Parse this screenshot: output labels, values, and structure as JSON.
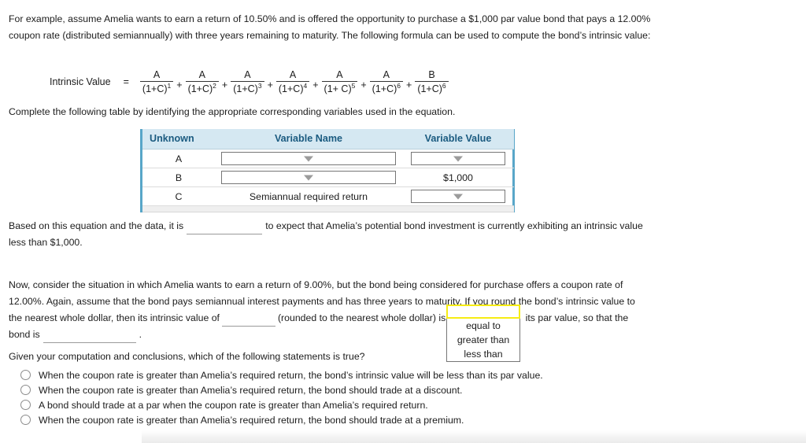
{
  "intro_paragraph": "For example, assume Amelia wants to earn a return of 10.50% and is offered the opportunity to purchase a $1,000 par value bond that pays a 12.00% coupon rate (distributed semiannually) with three years remaining to maturity. The following formula can be used to compute the bond’s intrinsic value:",
  "formula": {
    "label": "Intrinsic Value",
    "equals": "=",
    "plus": "+",
    "terms": [
      {
        "numerator": "A",
        "base": "(1+C)",
        "exponent": "1"
      },
      {
        "numerator": "A",
        "base": "(1+C)",
        "exponent": "2"
      },
      {
        "numerator": "A",
        "base": "(1+C)",
        "exponent": "3"
      },
      {
        "numerator": "A",
        "base": "(1+C)",
        "exponent": "4"
      },
      {
        "numerator": "A",
        "base": "(1+ C)",
        "exponent": "5"
      },
      {
        "numerator": "A",
        "base": "(1+C)",
        "exponent": "6"
      },
      {
        "numerator": "B",
        "base": "(1+C)",
        "exponent": "6"
      }
    ]
  },
  "complete_line": "Complete the following table by identifying the appropriate corresponding variables used in the equation.",
  "table": {
    "headers": [
      "Unknown",
      "Variable Name",
      "Variable Value"
    ],
    "rows": [
      {
        "unknown": "A",
        "variable_name": "",
        "variable_name_type": "select",
        "variable_value": "",
        "variable_value_type": "select"
      },
      {
        "unknown": "B",
        "variable_name": "",
        "variable_name_type": "select",
        "variable_value": "$1,000",
        "variable_value_type": "text"
      },
      {
        "unknown": "C",
        "variable_name": "Semiannual required return",
        "variable_name_type": "text",
        "variable_value": "",
        "variable_value_type": "select"
      }
    ]
  },
  "based_paragraph": {
    "part1": "Based on this equation and the data, it is",
    "part2": "to expect that Amelia’s potential bond investment is currently exhibiting an intrinsic value less than $1,000."
  },
  "now_paragraph": {
    "part1": "Now, consider the situation in which Amelia wants to earn a return of 9.00%, but the bond being considered for purchase offers a coupon rate of 12.00%. Again, assume that the bond pays semiannual interest payments and has three years to maturity. If you round the bond’s intrinsic value to the nearest whole dollar, then its intrinsic value of",
    "part2": "(rounded to the nearest whole dollar) is",
    "part3": "its par value, so that the bond is",
    "part4": "."
  },
  "dropdown": {
    "selected": "",
    "options": [
      "equal to",
      "greater than",
      "less than"
    ],
    "highlight_color": "#f6ec13"
  },
  "question_line": "Given your computation and conclusions, which of the following statements is true?",
  "choices": [
    "When the coupon rate is greater than Amelia’s required return, the bond’s intrinsic value will be less than its par value.",
    "When the coupon rate is greater than Amelia’s required return, the bond should trade at a discount.",
    "A bond should trade at a par when the coupon rate is greater than Amelia’s required return.",
    "When the coupon rate is greater than Amelia’s required return, the bond should trade at a premium."
  ],
  "colors": {
    "table_header_bg": "#d5e8f2",
    "table_header_text": "#1b5b80",
    "table_side_border": "#58a6c8",
    "highlight": "#f6ec13"
  }
}
